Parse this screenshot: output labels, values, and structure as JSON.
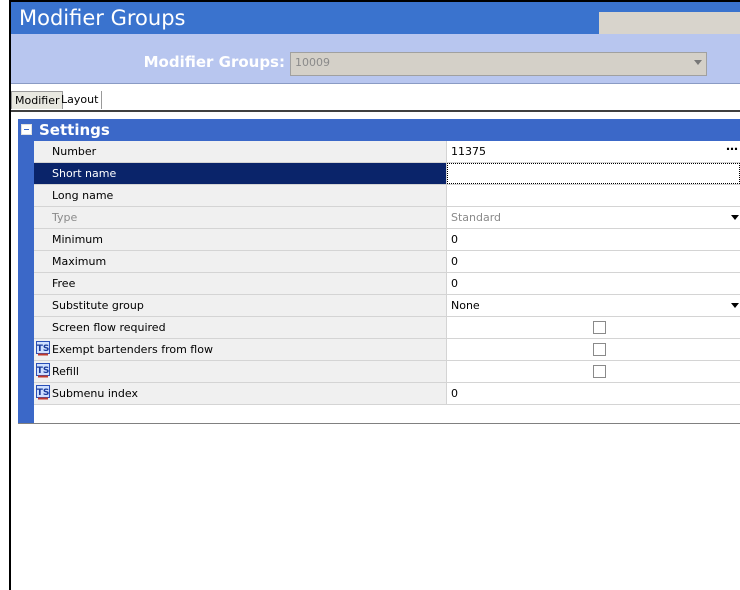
{
  "window": {
    "title": "Modifier Groups"
  },
  "selector": {
    "label": "Modifier Groups:",
    "value": "10009"
  },
  "tabs": [
    {
      "label": "Modifier",
      "active": true
    },
    {
      "label": "Layout",
      "active": false
    }
  ],
  "section": {
    "title": "Settings"
  },
  "rows": [
    {
      "label": "Number",
      "value": "11375",
      "control": "ellipsis"
    },
    {
      "label": "Short name",
      "value": "",
      "selected": true
    },
    {
      "label": "Long name",
      "value": ""
    },
    {
      "label": "Type",
      "value": "Standard",
      "control": "dropdown",
      "disabled": true
    },
    {
      "label": "Minimum",
      "value": "0"
    },
    {
      "label": "Maximum",
      "value": "0"
    },
    {
      "label": "Free",
      "value": "0"
    },
    {
      "label": "Substitute group",
      "value": "None",
      "control": "dropdown"
    },
    {
      "label": "Screen flow required",
      "control": "checkbox",
      "checked": false
    },
    {
      "label": "Exempt bartenders from flow",
      "control": "checkbox",
      "checked": false,
      "icon": "ts-icon"
    },
    {
      "label": "Refill",
      "control": "checkbox",
      "checked": false,
      "icon": "ts-icon"
    },
    {
      "label": "Submenu index",
      "value": "0",
      "icon": "ts-icon"
    }
  ],
  "colors": {
    "titlebar": "#3a73ce",
    "selectorbar": "#b8c6ef",
    "grid_header": "#3b68c8",
    "selection": "#0a246a"
  }
}
